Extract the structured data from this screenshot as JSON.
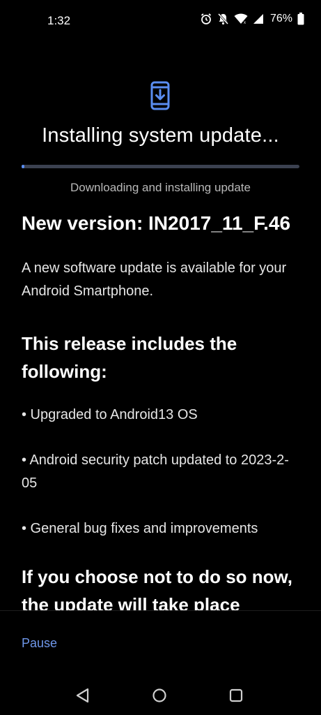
{
  "status_bar": {
    "time": "1:32",
    "battery": "76%",
    "icons": [
      "alarm-icon",
      "notifications-off-icon",
      "wifi-icon",
      "signal-icon",
      "battery-icon"
    ]
  },
  "update": {
    "title": "Installing system update...",
    "subtitle": "Downloading and installing update",
    "progress_percent": 1,
    "version": "New version: IN2017_11_F.46",
    "description": "A new software update is available for your Android Smartphone.",
    "includes_heading": "This release includes the following:",
    "bullets": [
      "• Upgraded to Android13 OS",
      "• Android security patch updated to 2023-2-05",
      "• General bug fixes and improvements"
    ],
    "bottom_heading": "If you choose not to do so now, the update will take place"
  },
  "actions": {
    "pause_label": "Pause"
  },
  "colors": {
    "accent": "#5a8df0",
    "link": "#6f97ea",
    "background": "#000000"
  }
}
